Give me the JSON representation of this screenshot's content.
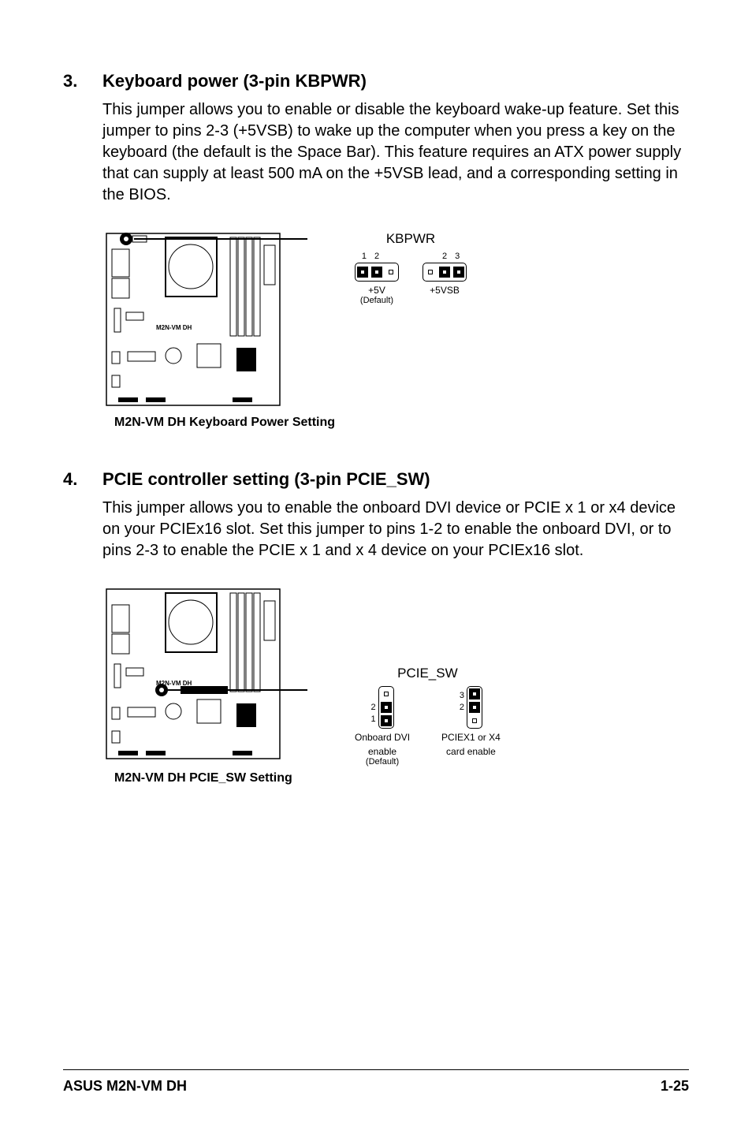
{
  "sections": [
    {
      "number": "3.",
      "title": "Keyboard power (3-pin KBPWR)",
      "body": "This jumper allows you to enable or disable the keyboard wake-up feature. Set this jumper to pins 2-3 (+5VSB) to wake up the computer when you press a key on the keyboard (the default is the Space Bar). This feature requires an ATX power supply that can supply at least 500 mA on the +5VSB lead, and a corresponding setting in the BIOS.",
      "jumper_header": "KBPWR",
      "caption": "M2N-VM DH Keyboard Power Setting",
      "pin_labels_a": [
        "1",
        "2"
      ],
      "pin_labels_b": [
        "2",
        "3"
      ],
      "label_a": "+5V",
      "default_a": "(Default)",
      "label_b": "+5VSB",
      "board_label": "M2N-VM DH"
    },
    {
      "number": "4.",
      "title": "PCIE controller setting (3-pin PCIE_SW)",
      "body": "This jumper allows you to enable the onboard DVI device or PCIE x 1 or x4 device on your PCIEx16 slot. Set this jumper to pins 1-2 to enable the onboard DVI, or to pins 2-3 to enable the PCIE x 1 and x 4 device on your PCIEx16 slot.",
      "jumper_header": "PCIE_SW",
      "caption": "M2N-VM DH PCIE_SW Setting",
      "pin_labels_a": [
        "1",
        "2"
      ],
      "pin_labels_b": [
        "2",
        "3"
      ],
      "label_a1": "Onboard DVI",
      "label_a2": "enable",
      "default_a": "(Default)",
      "label_b1": "PCIEX1 or X4",
      "label_b2": "card enable",
      "board_label": "M2N-VM DH"
    }
  ],
  "footer": {
    "left": "ASUS M2N-VM DH",
    "right": "1-25"
  }
}
